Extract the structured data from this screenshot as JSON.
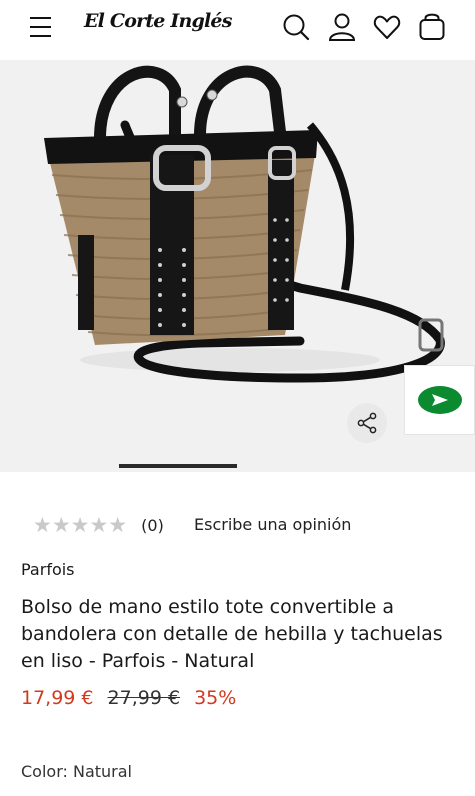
{
  "header": {
    "logo_text": "El Corte Inglés",
    "icons": [
      "menu-icon",
      "search-icon",
      "user-icon",
      "heart-icon",
      "bag-icon"
    ]
  },
  "gallery": {
    "image_alt": "Bolso tote de rafia natural con asas y correas negras con hebillas y tachuelas",
    "share_icon": "share-icon",
    "video_icon": "play-icon"
  },
  "product": {
    "rating": {
      "stars": "★★★★★",
      "count": "(0)",
      "review_link": "Escribe una opinión"
    },
    "brand": "Parfois",
    "title": "Bolso de mano estilo tote convertible a bandolera con detalle de hebilla y tachuelas en liso - Parfois - Natural",
    "price_current": "17,99 €",
    "price_original": "27,99 €",
    "discount": "35%",
    "color_label": "Color: Natural"
  },
  "colors": {
    "price": "#d3391e",
    "play_button": "#0b8a2f"
  }
}
